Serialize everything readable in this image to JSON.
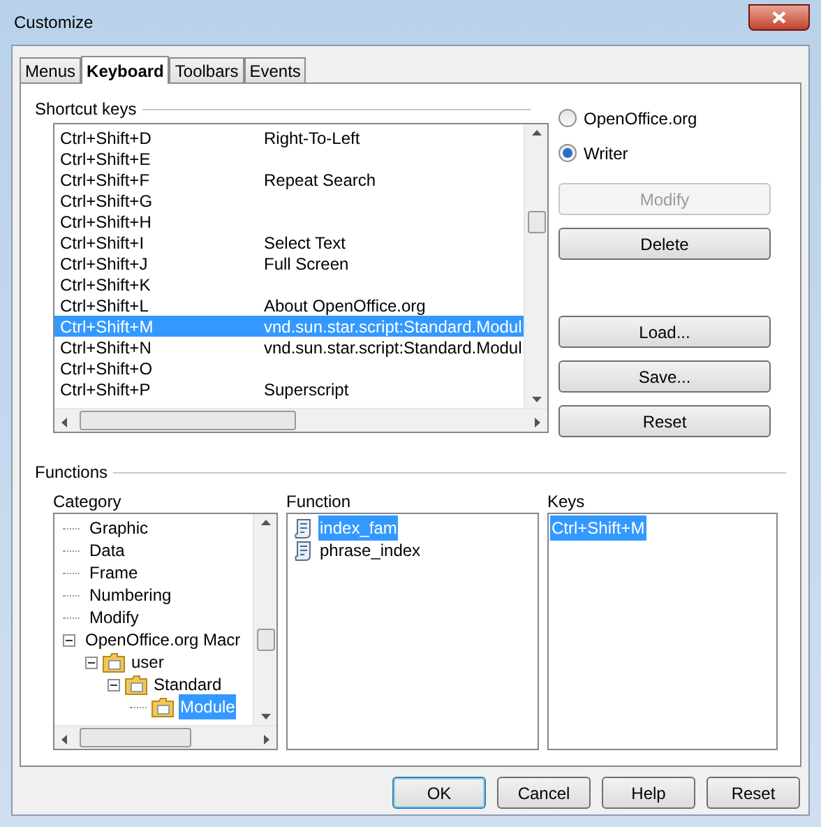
{
  "window": {
    "title": "Customize"
  },
  "tabs": [
    {
      "label": "Menus",
      "selected": false
    },
    {
      "label": "Keyboard",
      "selected": true
    },
    {
      "label": "Toolbars",
      "selected": false
    },
    {
      "label": "Events",
      "selected": false
    }
  ],
  "shortcut_keys": {
    "title": "Shortcut keys",
    "rows": [
      {
        "key": "Ctrl+Shift+D",
        "command": "Right-To-Left",
        "selected": false
      },
      {
        "key": "Ctrl+Shift+E",
        "selected": false
      },
      {
        "key": "Ctrl+Shift+F",
        "command": "Repeat Search",
        "selected": false
      },
      {
        "key": "Ctrl+Shift+G",
        "selected": false
      },
      {
        "key": "Ctrl+Shift+H",
        "selected": false
      },
      {
        "key": "Ctrl+Shift+I",
        "command": "Select Text",
        "selected": false
      },
      {
        "key": "Ctrl+Shift+J",
        "command": "Full Screen",
        "selected": false
      },
      {
        "key": "Ctrl+Shift+K",
        "selected": false
      },
      {
        "key": "Ctrl+Shift+L",
        "command": "About OpenOffice.org",
        "selected": false
      },
      {
        "key": "Ctrl+Shift+M",
        "command": "vnd.sun.star.script:Standard.Modul",
        "selected": true
      },
      {
        "key": "Ctrl+Shift+N",
        "command": "vnd.sun.star.script:Standard.Modul",
        "selected": false
      },
      {
        "key": "Ctrl+Shift+O",
        "selected": false
      },
      {
        "key": "Ctrl+Shift+P",
        "command": "Superscript",
        "selected": false
      }
    ]
  },
  "scope": [
    {
      "label": "OpenOffice.org",
      "selected": false
    },
    {
      "label": "Writer",
      "selected": true
    }
  ],
  "side_buttons": [
    [
      {
        "label": "Modify",
        "disabled": true
      },
      {
        "label": "Delete",
        "disabled": false
      }
    ],
    [
      {
        "label": "Load...",
        "disabled": false
      },
      {
        "label": "Save...",
        "disabled": false
      },
      {
        "label": "Reset",
        "disabled": false
      }
    ]
  ],
  "functions": {
    "title": "Functions",
    "category": {
      "label": "Category",
      "tree": [
        {
          "label": "Graphic",
          "selected": false
        },
        {
          "label": "Data",
          "selected": false
        },
        {
          "label": "Frame",
          "selected": false
        },
        {
          "label": "Numbering",
          "selected": false
        },
        {
          "label": "Modify",
          "selected": false
        },
        {
          "label": "OpenOffice.org Macr",
          "selected": false,
          "expanded": true,
          "children": [
            {
              "label": "user",
              "selected": false,
              "expanded": true,
              "kind": "folder",
              "children": [
                {
                  "label": "Standard",
                  "selected": false,
                  "expanded": true,
                  "kind": "folder",
                  "children": [
                    {
                      "label": "Module",
                      "selected": true,
                      "kind": "folder"
                    }
                  ]
                }
              ]
            }
          ]
        }
      ]
    },
    "function": {
      "label": "Function",
      "items": [
        {
          "label": "index_fam",
          "selected": true
        },
        {
          "label": "phrase_index",
          "selected": false
        }
      ]
    },
    "keys": {
      "label": "Keys",
      "items": [
        {
          "label": "Ctrl+Shift+M",
          "selected": true
        }
      ]
    }
  },
  "buttons": [
    {
      "label": "OK",
      "default": true
    },
    {
      "label": "Cancel",
      "default": false
    },
    {
      "label": "Help",
      "default": false
    },
    {
      "label": "Reset",
      "default": false
    }
  ]
}
